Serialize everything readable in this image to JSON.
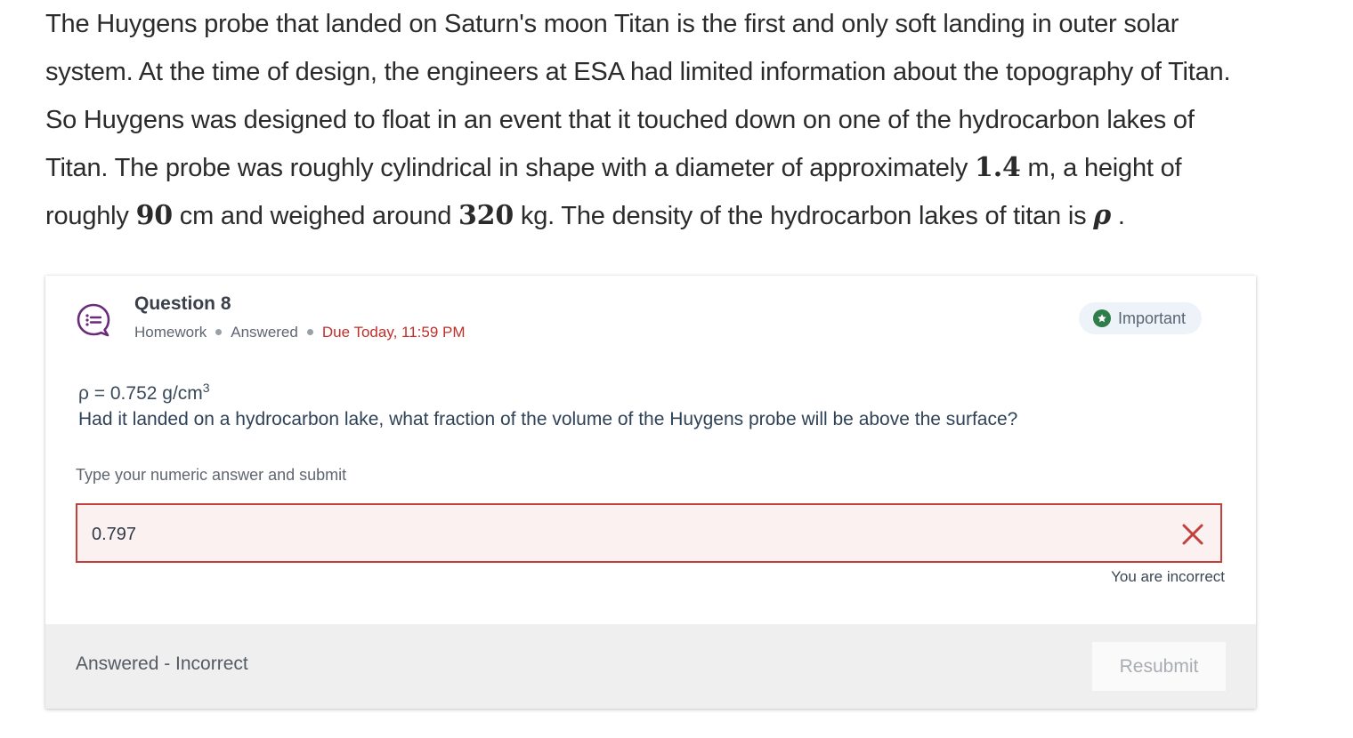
{
  "passage": {
    "line1": "The Huygens probe that landed on Saturn's moon Titan is the first and only soft landing in outer solar",
    "line2": "system. At the time of design, the engineers at ESA had limited information about the topography of Titan.",
    "line3": "So Huygens was designed to float in an event that it touched down on one of the hydrocarbon lakes of",
    "line4_pre": "Titan. The probe was roughly cylindrical in shape with a diameter of approximately ",
    "diameter_value": "1.4",
    "line4_post": " m, a height of",
    "line5_pre": "roughly ",
    "height_value": "90",
    "line5_mid1": " cm and weighed around ",
    "mass_value": "320",
    "line5_mid2": " kg. The density of the hydrocarbon lakes of titan is ",
    "density_symbol": "ρ",
    "line5_end": " ."
  },
  "question": {
    "icon": "question-list-icon",
    "title": "Question 8",
    "type": "Homework",
    "status": "Answered",
    "due": "Due Today, 11:59 PM",
    "important_label": "Important",
    "important_icon": "star-icon",
    "rho_text": "ρ = 0.752 g/cm",
    "rho_exponent": "3",
    "prompt": "Had it landed on a hydrocarbon lake, what fraction of the volume of the Huygens probe will be above the surface?",
    "answer_label": "Type your numeric answer and submit",
    "answer_value": "0.797",
    "result_icon": "x-icon",
    "result_message": "You are incorrect",
    "footer_status": "Answered - Incorrect",
    "resubmit_label": "Resubmit"
  },
  "colors": {
    "accent_purple": "#6b2a7a",
    "error_red": "#c2413d",
    "important_green": "#2e7d4a"
  }
}
